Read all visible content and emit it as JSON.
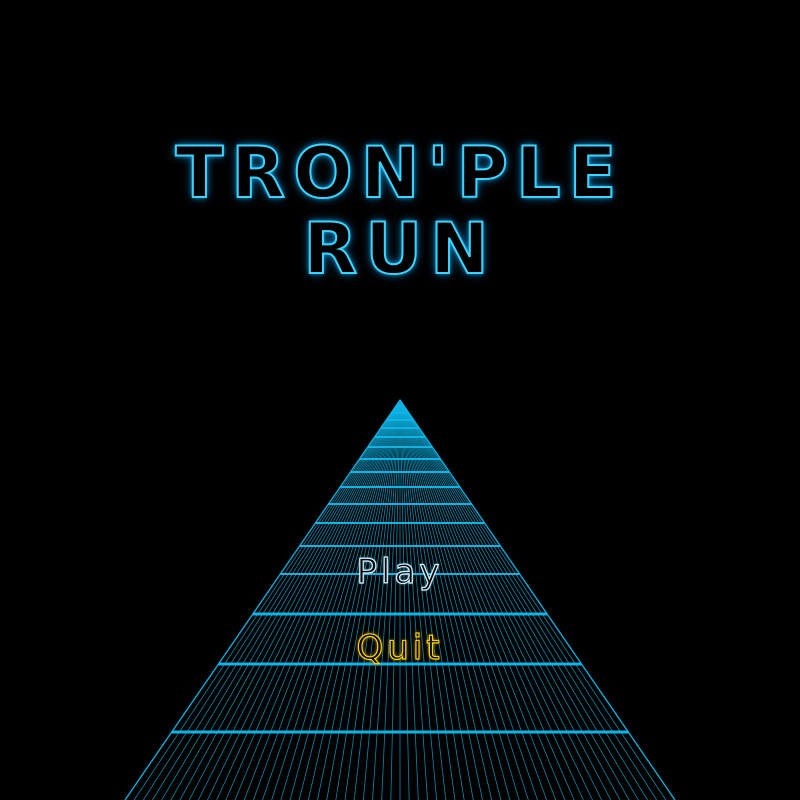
{
  "game": {
    "title_line_1": "TRON'PLE",
    "title_line_2": "RUN"
  },
  "menu": {
    "items": [
      {
        "label": "Play",
        "state": "normal"
      },
      {
        "label": "Quit",
        "state": "selected"
      }
    ]
  },
  "colors": {
    "background": "#000000",
    "grid_line": "#0fb4e6",
    "title_glow": "#3ad4ff",
    "menu_normal": "#d8f2ff",
    "menu_selected": "#ffd000"
  }
}
